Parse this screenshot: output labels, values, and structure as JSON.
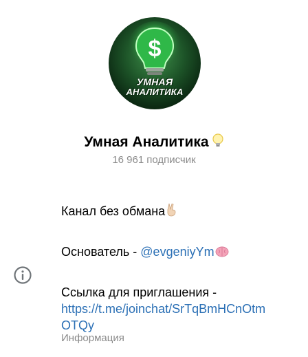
{
  "avatar": {
    "line1": "УМНАЯ",
    "line2": "АНАЛИТИКА",
    "icon": "lightbulb-dollar-icon",
    "colors": {
      "bg": "#0c2a13",
      "glow": "#3fe060",
      "dollar": "#ffffff"
    }
  },
  "channel": {
    "title": "Умная Аналитика",
    "title_emoji": "lightbulb-icon",
    "subscriber_count": "16 961",
    "subscriber_label": "подписчик"
  },
  "info": {
    "icon": "info-icon",
    "line1": "Канал без обмана",
    "line1_emoji": "victory-hand-icon",
    "founder_prefix": "Основатель -",
    "founder_handle": "@evgeniyYm",
    "founder_emoji": "brain-icon",
    "invite_label": "Ссылка для приглашения -",
    "invite_link_part1": "https://t.me/joinchat/SrTqBmHCnOtm",
    "invite_link_part2": "OTQy",
    "section_label": "Информация",
    "link_color": "#2a6fb5",
    "muted_color": "#8a8a8a"
  }
}
